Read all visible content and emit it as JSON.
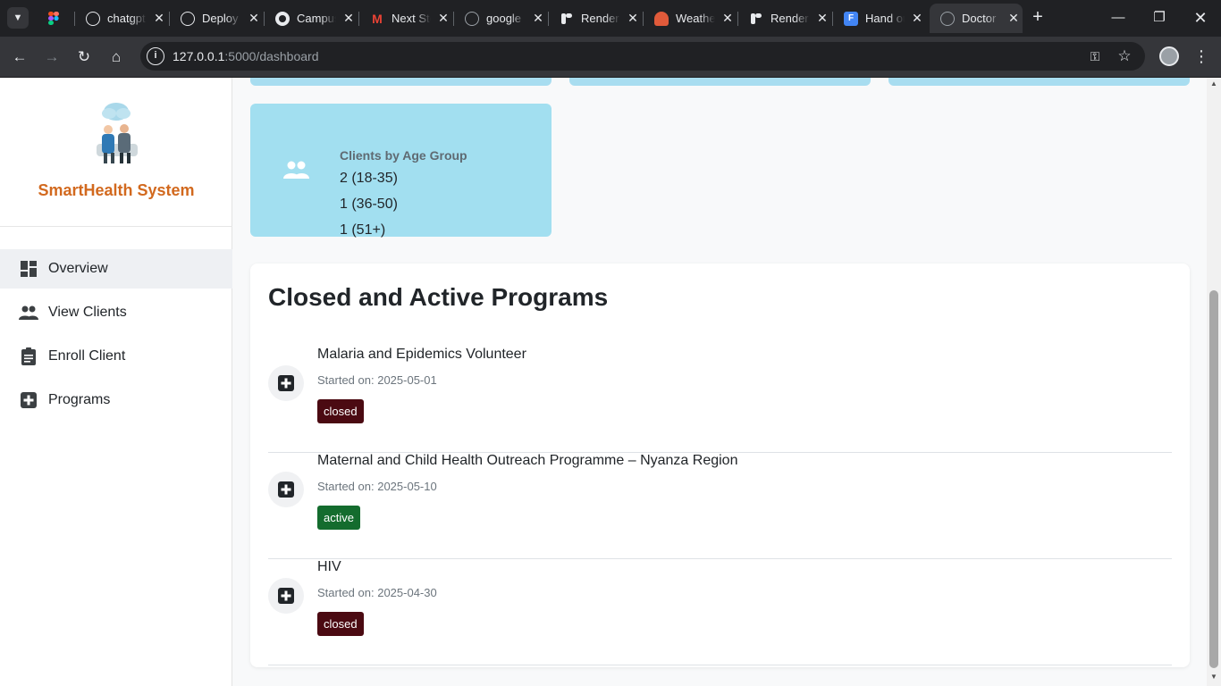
{
  "browser": {
    "tabs": [
      {
        "title": "",
        "icon": "figma-icon"
      },
      {
        "title": "chatgpt",
        "icon": "openai-icon"
      },
      {
        "title": "Deploy",
        "icon": "openai-icon"
      },
      {
        "title": "Campus",
        "icon": "github-icon"
      },
      {
        "title": "Next Steps",
        "icon": "gmail-icon"
      },
      {
        "title": "google",
        "icon": "globe-icon"
      },
      {
        "title": "Render",
        "icon": "render-icon"
      },
      {
        "title": "Weather",
        "icon": "weather-icon"
      },
      {
        "title": "Render",
        "icon": "render-icon"
      },
      {
        "title": "Hand out",
        "icon": "forms-icon"
      },
      {
        "title": "Doctor",
        "icon": "globe-icon"
      }
    ],
    "active_tab_index": 10,
    "url_host": "127.0.0.1",
    "url_rest": ":5000/dashboard",
    "colors": {
      "chrome_dark": "#202124",
      "chrome_bar": "#35363a"
    }
  },
  "sidebar": {
    "brand": "SmartHealth System",
    "items": [
      {
        "label": "Overview",
        "icon": "dashboard-icon",
        "active": true
      },
      {
        "label": "View Clients",
        "icon": "people-icon",
        "active": false
      },
      {
        "label": "Enroll Client",
        "icon": "clipboard-icon",
        "active": false
      },
      {
        "label": "Programs",
        "icon": "plus-square-icon",
        "active": false
      }
    ]
  },
  "age_card": {
    "title": "Clients by Age Group",
    "lines": [
      "2 (18-35)",
      "1 (36-50)",
      "1 (51+)"
    ],
    "icon": "people-icon",
    "color": "#a2dff0"
  },
  "programs": {
    "title": "Closed and Active Programs",
    "date_prefix": "Started on:",
    "items": [
      {
        "name": "Malaria and Epidemics Volunteer",
        "started": "Started on: 2025-05-01",
        "status": "closed"
      },
      {
        "name": "Maternal and Child Health Outreach Programme – Nyanza Region",
        "started": "Started on: 2025-05-10",
        "status": "active"
      },
      {
        "name": "HIV",
        "started": "Started on: 2025-04-30",
        "status": "closed"
      }
    ],
    "status_colors": {
      "closed": "#4b0a12",
      "active": "#146c2e"
    }
  }
}
